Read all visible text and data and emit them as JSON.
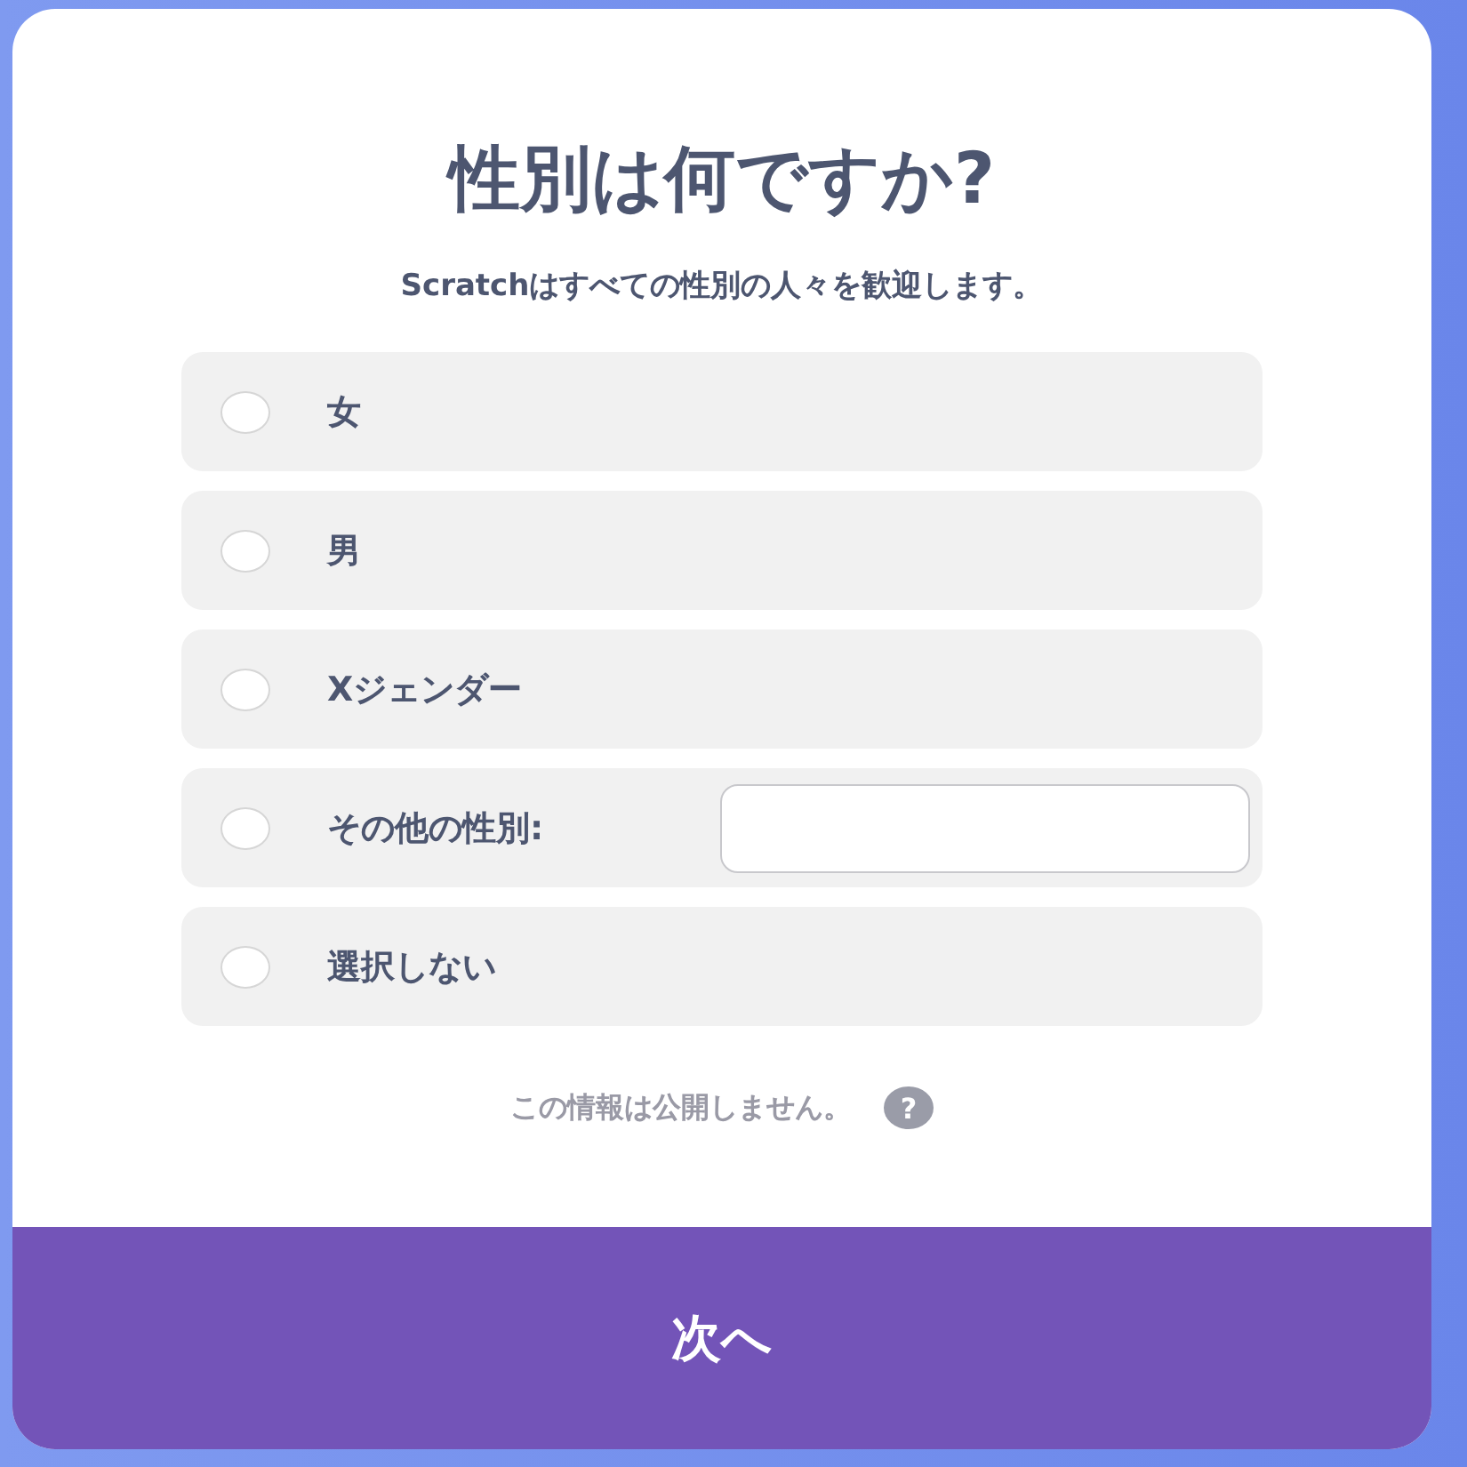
{
  "title": "性別は何ですか?",
  "subtitle": "Scratchはすべての性別の人々を歓迎します。",
  "options": [
    {
      "label": "女",
      "selected": false,
      "kind": "plain"
    },
    {
      "label": "男",
      "selected": false,
      "kind": "plain"
    },
    {
      "label": "Xジェンダー",
      "selected": false,
      "kind": "plain"
    },
    {
      "label": "その他の性別:",
      "selected": false,
      "kind": "with_input"
    },
    {
      "label": "選択しない",
      "selected": false,
      "kind": "plain"
    }
  ],
  "privacy_note": "この情報は公開しません。",
  "help_icon": "?",
  "next_button": "次へ"
}
